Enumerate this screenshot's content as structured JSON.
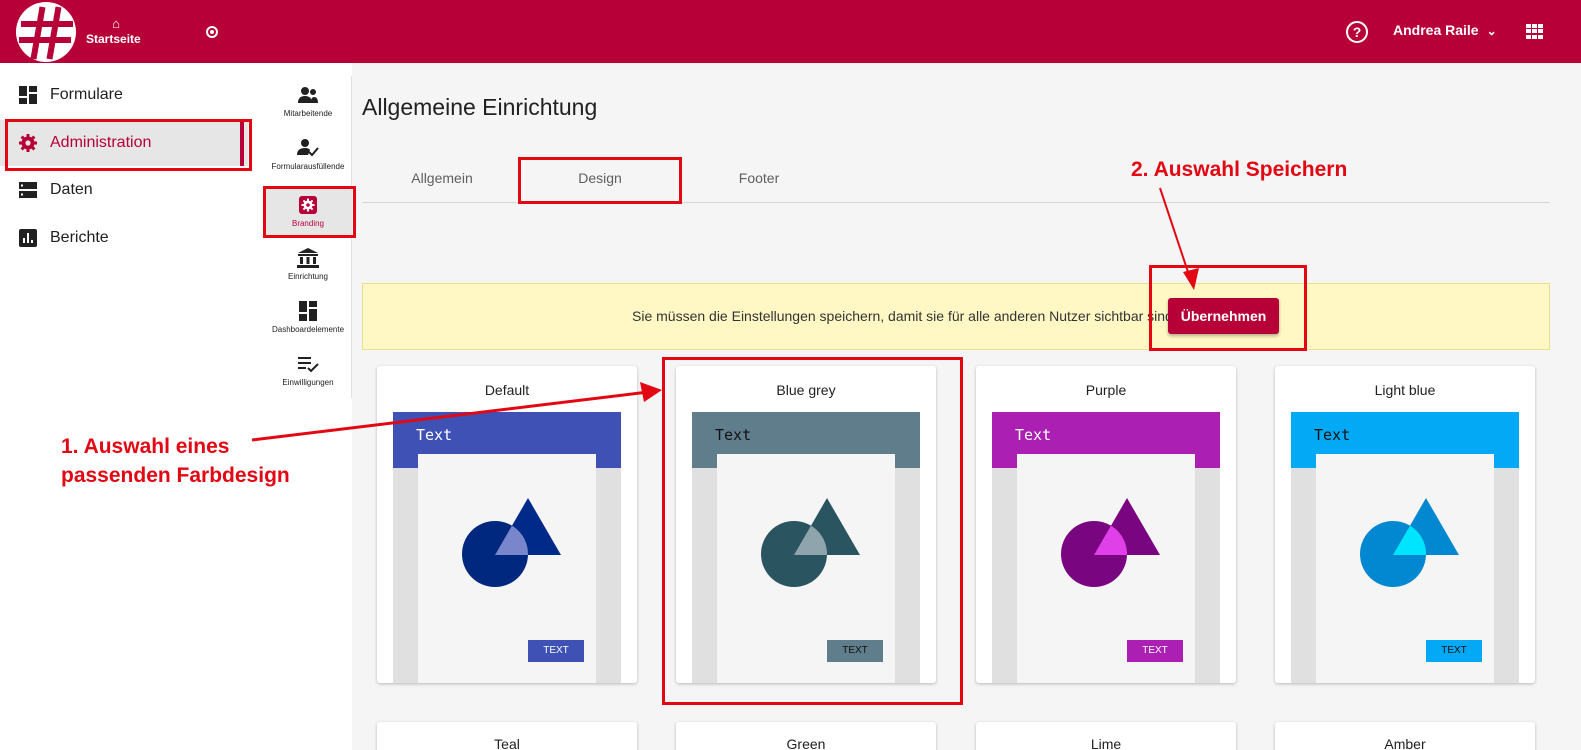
{
  "header": {
    "home_label": "Startseite",
    "help_icon": "?",
    "user_name": "Andrea Raile",
    "icons": [
      "logo-icon",
      "home-icon",
      "radio-icon",
      "help-icon",
      "chevron-down-icon",
      "apps-grid-icon"
    ]
  },
  "sidebar": {
    "items": [
      {
        "label": "Formulare",
        "icon": "dashboard-icon"
      },
      {
        "label": "Administration",
        "icon": "gear-icon",
        "active": true
      },
      {
        "label": "Daten",
        "icon": "storage-icon"
      },
      {
        "label": "Berichte",
        "icon": "bar-chart-icon"
      }
    ]
  },
  "subnav": {
    "items": [
      {
        "label": "Mitarbeitende",
        "icon": "people-icon"
      },
      {
        "label": "Formularausfüllende",
        "icon": "person-check-icon"
      },
      {
        "label": "Branding",
        "icon": "gear-icon",
        "active": true
      },
      {
        "label": "Einrichtung",
        "icon": "institution-icon"
      },
      {
        "label": "Dashboardelemente",
        "icon": "dashboard-icon"
      },
      {
        "label": "Einwilligungen",
        "icon": "checklist-icon"
      }
    ]
  },
  "main": {
    "title": "Allgemeine Einrichtung",
    "tabs": [
      {
        "label": "Allgemein"
      },
      {
        "label": "Design",
        "selected": true
      },
      {
        "label": "Footer"
      }
    ],
    "notice": {
      "text": "Sie müssen die Einstellungen speichern, damit sie für alle anderen Nutzer sichtbar sind",
      "button_label": "Übernehmen"
    },
    "themes": [
      {
        "name": "Default",
        "header_color": "#3f51b5",
        "circle_color": "#00287e",
        "triangle_color": "#002a8a",
        "overlap_color": "#7986cb",
        "button_color": "#3f51b5",
        "button_text_color": "#ffffff",
        "header_text_color": "#ffffff",
        "preview_text": "Text",
        "button_text": "TEXT"
      },
      {
        "name": "Blue grey",
        "header_color": "#607d8b",
        "circle_color": "#2a5560",
        "triangle_color": "#2a5560",
        "overlap_color": "#90a4ae",
        "button_color": "#607d8b",
        "button_text_color": "#111111",
        "header_text_color": "#111111",
        "preview_text": "Text",
        "button_text": "TEXT"
      },
      {
        "name": "Purple",
        "header_color": "#ab20b3",
        "circle_color": "#7a0580",
        "triangle_color": "#7a0580",
        "overlap_color": "#e040e8",
        "button_color": "#ab20b3",
        "button_text_color": "#ffffff",
        "header_text_color": "#ffffff",
        "preview_text": "Text",
        "button_text": "TEXT"
      },
      {
        "name": "Light blue",
        "header_color": "#03a9f4",
        "circle_color": "#0288d1",
        "triangle_color": "#0288d1",
        "overlap_color": "#00e5ff",
        "button_color": "#03a9f4",
        "button_text_color": "#111111",
        "header_text_color": "#111111",
        "preview_text": "Text",
        "button_text": "TEXT"
      }
    ],
    "more_themes": [
      "Teal",
      "Green",
      "Lime",
      "Amber"
    ]
  },
  "annotations": {
    "step1_line1": "1. Auswahl eines",
    "step1_line2": "passenden Farbdesign",
    "step2": "2. Auswahl Speichern",
    "color": "#e30613"
  },
  "colors": {
    "brand": "#b80038",
    "notice_bg": "#fff8c4"
  }
}
